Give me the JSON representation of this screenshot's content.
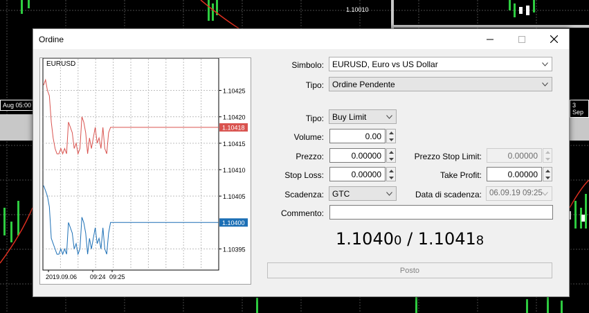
{
  "background": {
    "price_label": "1.10010",
    "date_left": "Aug 05:00",
    "date_right": "3 Sep"
  },
  "dialog": {
    "title": "Ordine"
  },
  "chart": {
    "symbol": "EURUSD",
    "ask_price_tag": "1.10418",
    "bid_price_tag": "1.10400",
    "ask_color": "#d9534f",
    "bid_color": "#1c6fb5",
    "y_ticks": [
      "1.10425",
      "1.10420",
      "1.10415",
      "1.10410",
      "1.10405",
      "1.10395"
    ],
    "x_ticks": [
      "2019.09.06",
      "09:24",
      "09:25"
    ]
  },
  "chart_data": {
    "type": "line",
    "title": "EURUSD",
    "ylim": [
      1.10391,
      1.10429
    ],
    "series": [
      {
        "values": [
          1.10426,
          1.10427,
          1.10425,
          1.10424,
          1.10419,
          1.10416,
          1.10414,
          1.10413,
          1.10413,
          1.10414,
          1.10413,
          1.10414,
          1.10413,
          1.10419,
          1.10418,
          1.10417,
          1.10414,
          1.10415,
          1.10413,
          1.10414,
          1.1042,
          1.10419,
          1.10417,
          1.10413,
          1.10416,
          1.10414,
          1.10416,
          1.10418,
          1.10415,
          1.10416,
          1.10414,
          1.10418,
          1.10414,
          1.10413,
          1.10417,
          1.10418,
          1.10418,
          1.10418,
          1.10418
        ]
      },
      {
        "values": [
          1.10407,
          1.10406,
          1.10405,
          1.10403,
          1.10397,
          1.10396,
          1.10395,
          1.10394,
          1.10394,
          1.10395,
          1.10394,
          1.10395,
          1.10394,
          1.104,
          1.10399,
          1.10398,
          1.10395,
          1.10396,
          1.10394,
          1.10395,
          1.10401,
          1.104,
          1.10398,
          1.10394,
          1.10397,
          1.10395,
          1.10397,
          1.10399,
          1.10396,
          1.10397,
          1.10395,
          1.10399,
          1.10395,
          1.10394,
          1.10398,
          1.104,
          1.104,
          1.104,
          1.104
        ]
      }
    ]
  },
  "form": {
    "simbolo_label": "Simbolo:",
    "simbolo_value": "EURUSD, Euro vs US Dollar",
    "tipo1_label": "Tipo:",
    "tipo1_value": "Ordine Pendente",
    "tipo2_label": "Tipo:",
    "tipo2_value": "Buy Limit",
    "volume_label": "Volume:",
    "volume_value": "0.00",
    "prezzo_label": "Prezzo:",
    "prezzo_value": "0.00000",
    "stop_limit_label": "Prezzo Stop Limit:",
    "stop_limit_value": "0.00000",
    "stop_loss_label": "Stop Loss:",
    "stop_loss_value": "0.00000",
    "take_profit_label": "Take Profit:",
    "take_profit_value": "0.00000",
    "scadenza_label": "Scadenza:",
    "scadenza_value": "GTC",
    "data_scadenza_label": "Data di scadenza:",
    "data_scadenza_value": "06.09.19 09:25",
    "commento_label": "Commento:",
    "commento_value": ""
  },
  "quote": {
    "bid_main": "1.1040",
    "bid_small": "0",
    "separator": " / ",
    "ask_main": "1.1041",
    "ask_small": "8"
  },
  "posto_button": "Posto"
}
